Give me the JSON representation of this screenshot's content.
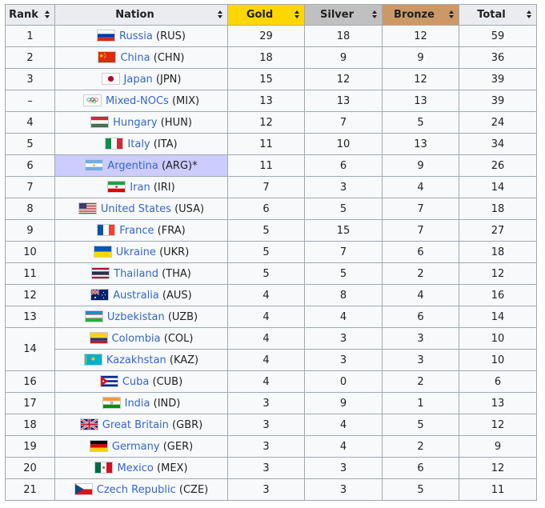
{
  "headers": [
    "Rank",
    "Nation",
    "Gold",
    "Silver",
    "Bronze",
    "Total"
  ],
  "rows": [
    {
      "rank": "1",
      "name": "Russia",
      "code": "(RUS)",
      "flag": "russia-flag",
      "gold": "29",
      "silver": "18",
      "bronze": "12",
      "total": "59"
    },
    {
      "rank": "2",
      "name": "China",
      "code": "(CHN)",
      "flag": "china-flag",
      "gold": "18",
      "silver": "9",
      "bronze": "9",
      "total": "36"
    },
    {
      "rank": "3",
      "name": "Japan",
      "code": "(JPN)",
      "flag": "japan-flag",
      "gold": "15",
      "silver": "12",
      "bronze": "12",
      "total": "39"
    },
    {
      "rank": "–",
      "name": "Mixed-NOCs",
      "code": "(MIX)",
      "flag": "olympic-rings-flag",
      "gold": "13",
      "silver": "13",
      "bronze": "13",
      "total": "39"
    },
    {
      "rank": "4",
      "name": "Hungary",
      "code": "(HUN)",
      "flag": "hungary-flag",
      "gold": "12",
      "silver": "7",
      "bronze": "5",
      "total": "24"
    },
    {
      "rank": "5",
      "name": "Italy",
      "code": "(ITA)",
      "flag": "italy-flag",
      "gold": "11",
      "silver": "10",
      "bronze": "13",
      "total": "34"
    },
    {
      "rank": "6",
      "name": "Argentina",
      "code": "(ARG)*",
      "flag": "argentina-flag",
      "gold": "11",
      "silver": "6",
      "bronze": "9",
      "total": "26",
      "host": true
    },
    {
      "rank": "7",
      "name": "Iran",
      "code": "(IRI)",
      "flag": "iran-flag",
      "gold": "7",
      "silver": "3",
      "bronze": "4",
      "total": "14"
    },
    {
      "rank": "8",
      "name": "United States",
      "code": "(USA)",
      "flag": "usa-flag",
      "gold": "6",
      "silver": "5",
      "bronze": "7",
      "total": "18"
    },
    {
      "rank": "9",
      "name": "France",
      "code": "(FRA)",
      "flag": "france-flag",
      "gold": "5",
      "silver": "15",
      "bronze": "7",
      "total": "27"
    },
    {
      "rank": "10",
      "name": "Ukraine",
      "code": "(UKR)",
      "flag": "ukraine-flag",
      "gold": "5",
      "silver": "7",
      "bronze": "6",
      "total": "18"
    },
    {
      "rank": "11",
      "name": "Thailand",
      "code": "(THA)",
      "flag": "thailand-flag",
      "gold": "5",
      "silver": "5",
      "bronze": "2",
      "total": "12"
    },
    {
      "rank": "12",
      "name": "Australia",
      "code": "(AUS)",
      "flag": "australia-flag",
      "gold": "4",
      "silver": "8",
      "bronze": "4",
      "total": "16"
    },
    {
      "rank": "13",
      "name": "Uzbekistan",
      "code": "(UZB)",
      "flag": "uzbekistan-flag",
      "gold": "4",
      "silver": "4",
      "bronze": "6",
      "total": "14"
    },
    {
      "rank": "14",
      "name": "Colombia",
      "code": "(COL)",
      "flag": "colombia-flag",
      "gold": "4",
      "silver": "3",
      "bronze": "3",
      "total": "10"
    },
    {
      "rank": "",
      "name": "Kazakhstan",
      "code": "(KAZ)",
      "flag": "kazakhstan-flag",
      "gold": "4",
      "silver": "3",
      "bronze": "3",
      "total": "10"
    },
    {
      "rank": "16",
      "name": "Cuba",
      "code": "(CUB)",
      "flag": "cuba-flag",
      "gold": "4",
      "silver": "0",
      "bronze": "2",
      "total": "6"
    },
    {
      "rank": "17",
      "name": "India",
      "code": "(IND)",
      "flag": "india-flag",
      "gold": "3",
      "silver": "9",
      "bronze": "1",
      "total": "13"
    },
    {
      "rank": "18",
      "name": "Great Britain",
      "code": "(GBR)",
      "flag": "great-britain-flag",
      "gold": "3",
      "silver": "4",
      "bronze": "5",
      "total": "12"
    },
    {
      "rank": "19",
      "name": "Germany",
      "code": "(GER)",
      "flag": "germany-flag",
      "gold": "3",
      "silver": "4",
      "bronze": "2",
      "total": "9"
    },
    {
      "rank": "20",
      "name": "Mexico",
      "code": "(MEX)",
      "flag": "mexico-flag",
      "gold": "3",
      "silver": "3",
      "bronze": "6",
      "total": "12"
    },
    {
      "rank": "21",
      "name": "Czech Republic",
      "code": "(CZE)",
      "flag": "czech-republic-flag",
      "gold": "3",
      "silver": "3",
      "bronze": "5",
      "total": "11"
    }
  ],
  "colors": {
    "gold_header": "#ffd700",
    "silver_header": "#c0c0c0",
    "bronze_header": "#cc9966",
    "host_highlight": "#ccccff",
    "link": "#3366cc"
  }
}
